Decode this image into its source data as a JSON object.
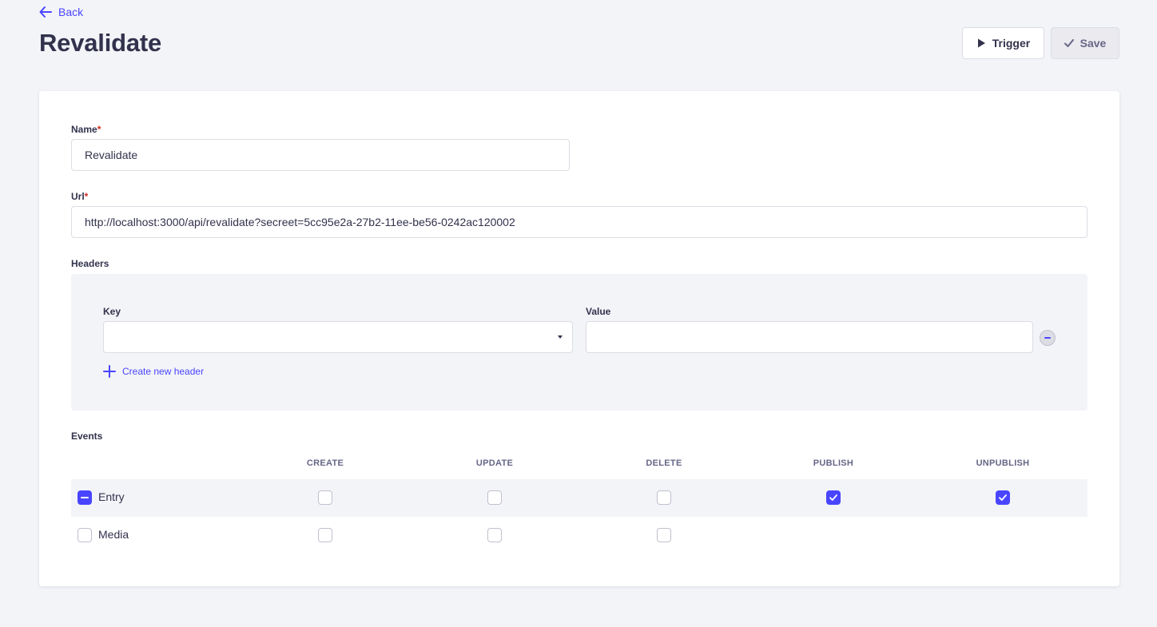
{
  "header": {
    "back_label": "Back",
    "title": "Revalidate",
    "trigger_label": "Trigger",
    "save_label": "Save"
  },
  "form": {
    "name": {
      "label": "Name",
      "required_mark": "*",
      "value": "Revalidate"
    },
    "url": {
      "label": "Url",
      "required_mark": "*",
      "value": "http://localhost:3000/api/revalidate?secreet=5cc95e2a-27b2-11ee-be56-0242ac120002"
    },
    "headers": {
      "label": "Headers",
      "key_label": "Key",
      "value_label": "Value",
      "key_value": "",
      "value_value": "",
      "create_label": "Create new header"
    },
    "events": {
      "label": "Events",
      "columns": [
        "CREATE",
        "UPDATE",
        "DELETE",
        "PUBLISH",
        "UNPUBLISH"
      ],
      "rows": [
        {
          "label": "Entry",
          "state": "indeterminate",
          "checks": [
            false,
            false,
            false,
            true,
            true
          ]
        },
        {
          "label": "Media",
          "state": "unchecked",
          "checks": [
            false,
            false,
            false
          ]
        }
      ]
    }
  },
  "colors": {
    "primary": "#4945ff",
    "background": "#f3f4f8",
    "text": "#32324d",
    "required": "#d02b20"
  }
}
